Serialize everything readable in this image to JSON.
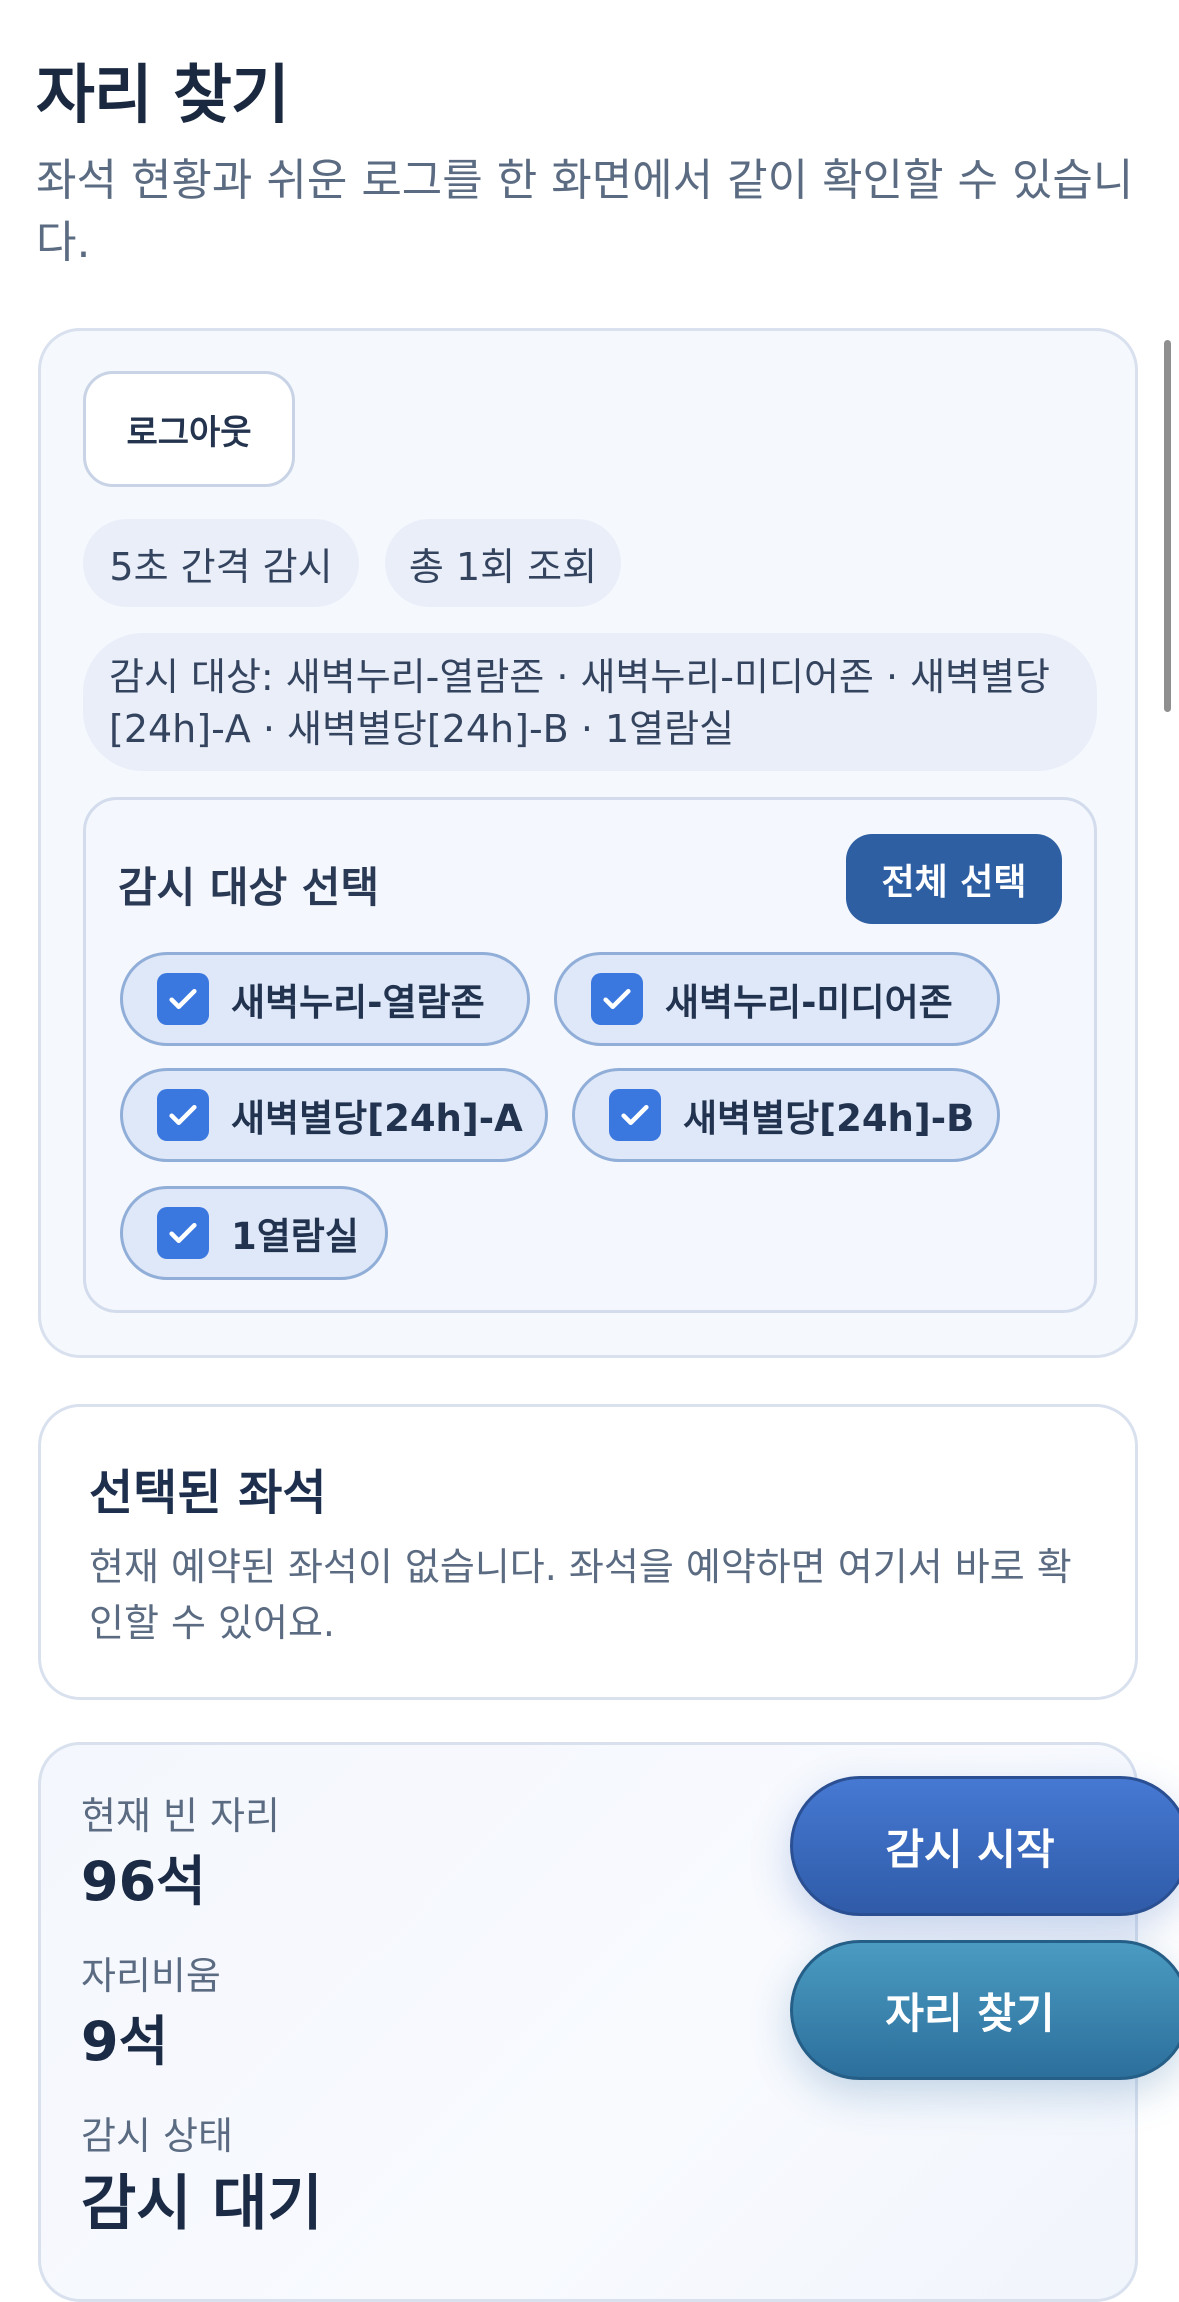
{
  "header": {
    "title": "자리 찾기",
    "subtitle": "좌석 현황과 쉬운 로그를 한 화면에서 같이 확인할 수 있습니다."
  },
  "monitor": {
    "logout_label": "로그아웃",
    "interval_label": "5초 간격 감시",
    "count_label": "총 1회 조회",
    "targets_label": "감시 대상: 새벽누리-열람존 · 새벽누리-미디어존 · 새벽별당[24h]-A · 새벽별당[24h]-B · 1열람실",
    "select_title": "감시 대상 선택",
    "select_all_label": "전체 선택",
    "options": [
      {
        "label": "새벽누리-열람존",
        "checked": true
      },
      {
        "label": "새벽누리-미디어존",
        "checked": true
      },
      {
        "label": "새벽별당[24h]-A",
        "checked": true
      },
      {
        "label": "새벽별당[24h]-B",
        "checked": true
      },
      {
        "label": "1열람실",
        "checked": true
      }
    ]
  },
  "selected_seat": {
    "title": "선택된 좌석",
    "description": "현재 예약된 좌석이 없습니다. 좌석을 예약하면 여기서 바로 확인할 수 있어요."
  },
  "status": {
    "empty_label": "현재 빈 자리",
    "empty_value": "96석",
    "soon_label": "자리비움",
    "soon_value": "9석",
    "state_label": "감시 상태",
    "state_value": "감시 대기"
  },
  "actions": {
    "start_label": "감시 시작",
    "find_label": "자리 찾기"
  },
  "colors": {
    "accent": "#2f5fa3",
    "check": "#3a78e0",
    "find_button": "#2c6f9c"
  }
}
